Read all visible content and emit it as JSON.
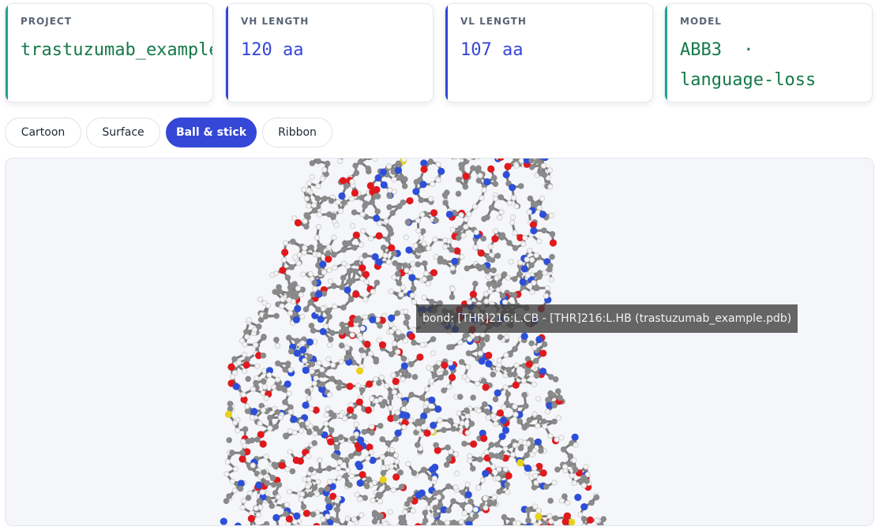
{
  "cards": [
    {
      "label": "PROJECT",
      "value": "trastuzumab_example",
      "accent": "#1aa58f",
      "value_color": "#14784a"
    },
    {
      "label": "VH LENGTH",
      "value": "120 aa",
      "accent": "#3547d6",
      "value_color": "#3547d6"
    },
    {
      "label": "VL LENGTH",
      "value": "107 aa",
      "accent": "#3547d6",
      "value_color": "#3547d6"
    },
    {
      "label": "MODEL",
      "value": "ABB3 · language-loss",
      "accent": "#1aa58f",
      "value_color": "#14784a"
    }
  ],
  "view_modes": {
    "items": [
      "Cartoon",
      "Surface",
      "Ball & stick",
      "Ribbon"
    ],
    "selected": "Ball & stick"
  },
  "viewer": {
    "tooltip": "bond: [THR]216:L.CB - [THR]216:L.HB (trastuzumab_example.pdb)",
    "atom_colors": {
      "carbon": "#8a8a8a",
      "oxygen": "#e0191d",
      "nitrogen": "#2d4fd8",
      "hydrogen": "#f4f4f4",
      "sulfur": "#e8d21a"
    }
  }
}
